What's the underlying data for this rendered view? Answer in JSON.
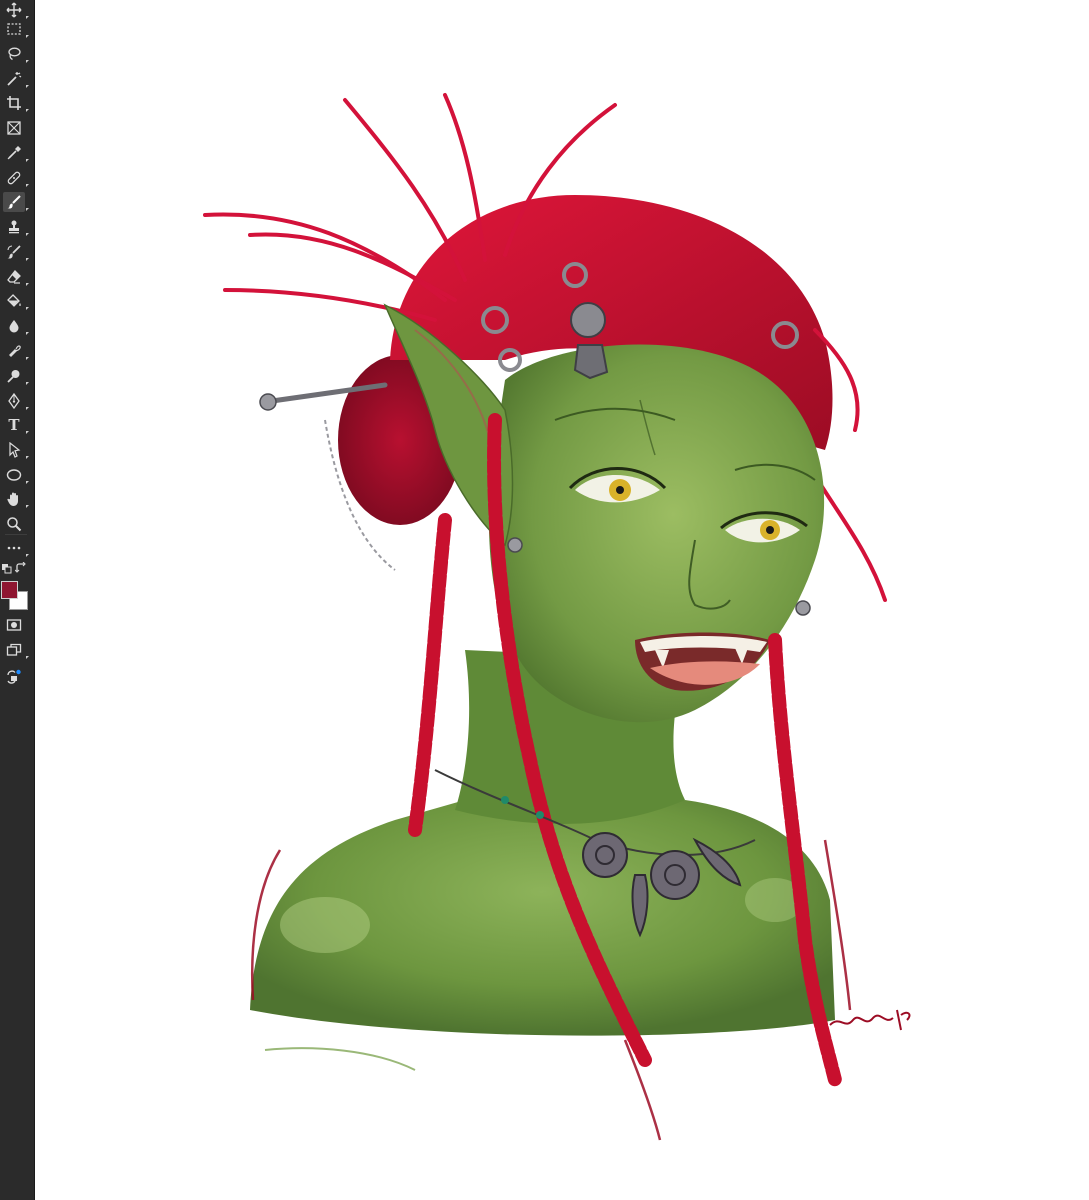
{
  "colors": {
    "toolbar_bg": "#2b2b2b",
    "icon": "#dcdcdc",
    "foreground_swatch": "#8e1530",
    "background_swatch": "#ffffff",
    "skin": "#6f9a3f",
    "hair": "#c8102e",
    "eye": "#d9b22a"
  },
  "toolbar": {
    "active_tool": "brush-tool",
    "tools": [
      {
        "name": "move-tool",
        "icon": "move-icon"
      },
      {
        "name": "rectangular-marquee-tool",
        "icon": "marquee-icon"
      },
      {
        "name": "lasso-tool",
        "icon": "lasso-icon"
      },
      {
        "name": "magic-wand-tool",
        "icon": "magic-wand-icon"
      },
      {
        "name": "crop-tool",
        "icon": "crop-icon"
      },
      {
        "name": "frame-tool",
        "icon": "frame-icon"
      },
      {
        "name": "eyedropper-tool",
        "icon": "eyedropper-icon"
      },
      {
        "name": "spot-healing-tool",
        "icon": "bandage-icon"
      },
      {
        "name": "brush-tool",
        "icon": "brush-icon"
      },
      {
        "name": "clone-stamp-tool",
        "icon": "stamp-icon"
      },
      {
        "name": "history-brush-tool",
        "icon": "history-brush-icon"
      },
      {
        "name": "eraser-tool",
        "icon": "eraser-icon"
      },
      {
        "name": "paint-bucket-tool",
        "icon": "bucket-icon"
      },
      {
        "name": "blur-tool",
        "icon": "drop-icon"
      },
      {
        "name": "smudge-tool",
        "icon": "smudge-icon"
      },
      {
        "name": "dodge-tool",
        "icon": "dodge-icon"
      },
      {
        "name": "pen-tool",
        "icon": "pen-icon"
      },
      {
        "name": "type-tool",
        "icon": "type-icon",
        "label": "T"
      },
      {
        "name": "path-selection-tool",
        "icon": "arrow-icon"
      },
      {
        "name": "ellipse-tool",
        "icon": "ellipse-icon"
      },
      {
        "name": "hand-tool",
        "icon": "hand-icon"
      },
      {
        "name": "zoom-tool",
        "icon": "zoom-icon"
      },
      {
        "name": "edit-toolbar",
        "icon": "more-icon"
      }
    ]
  }
}
